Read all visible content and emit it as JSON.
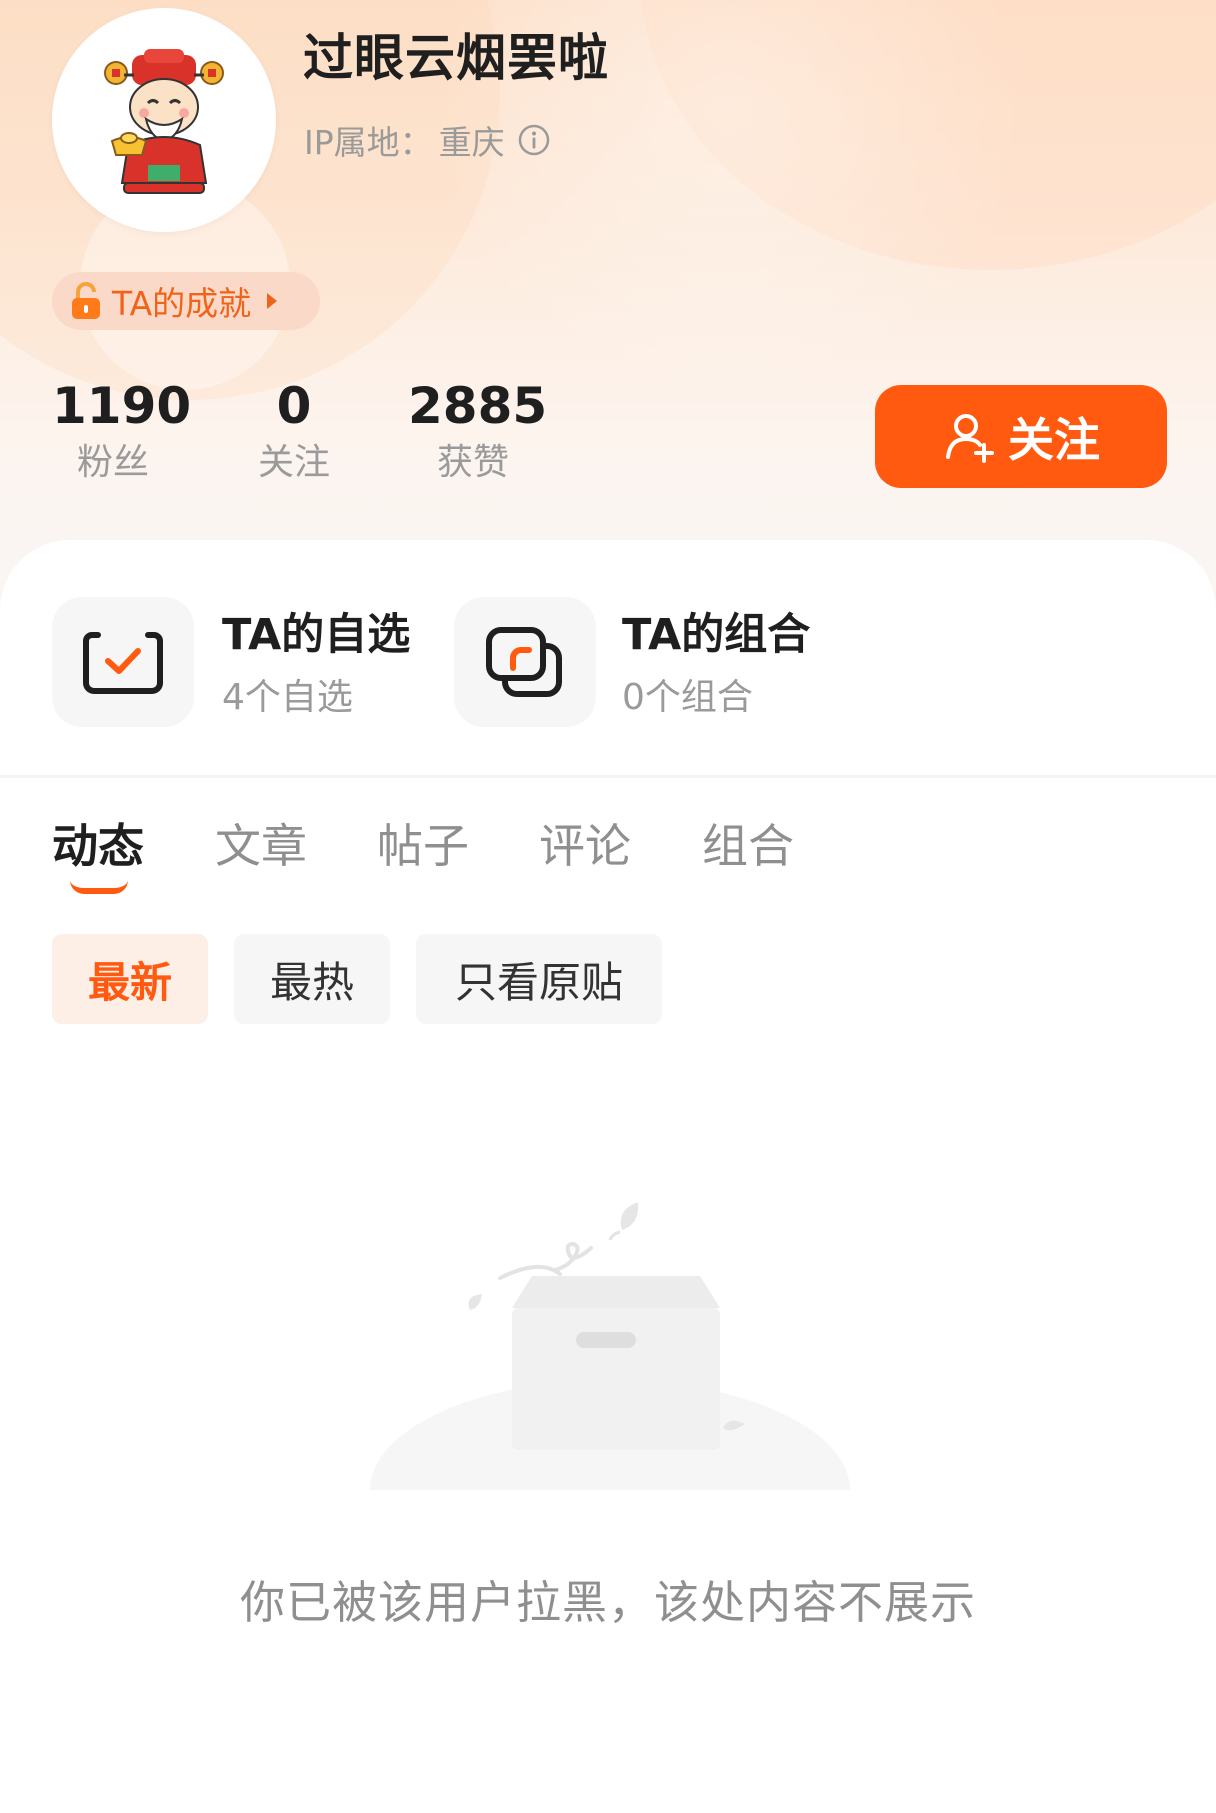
{
  "profile": {
    "username": "过眼云烟罢啦",
    "ip_label": "IP属地：",
    "ip_location": "重庆",
    "achievement_label": "TA的成就"
  },
  "stats": [
    {
      "value": "1190",
      "label": "粉丝"
    },
    {
      "value": "0",
      "label": "关注"
    },
    {
      "value": "2885",
      "label": "获赞"
    }
  ],
  "follow_button": {
    "label": "关注"
  },
  "shortcuts": [
    {
      "title": "TA的自选",
      "subtitle": "4个自选",
      "icon": "watchlist-check-icon"
    },
    {
      "title": "TA的组合",
      "subtitle": "0个组合",
      "icon": "portfolio-icon"
    }
  ],
  "tabs": [
    {
      "label": "动态",
      "active": true
    },
    {
      "label": "文章",
      "active": false
    },
    {
      "label": "帖子",
      "active": false
    },
    {
      "label": "评论",
      "active": false
    },
    {
      "label": "组合",
      "active": false
    }
  ],
  "filters": [
    {
      "label": "最新",
      "active": true
    },
    {
      "label": "最热",
      "active": false
    },
    {
      "label": "只看原贴",
      "active": false
    }
  ],
  "empty_state": {
    "message": "你已被该用户拉黑，该处内容不展示",
    "icon": "empty-box-icon"
  },
  "colors": {
    "accent": "#ff5a10",
    "accent_light": "#fdeee6",
    "text_primary": "#1f1f1f",
    "text_secondary": "#9a9a9a"
  }
}
